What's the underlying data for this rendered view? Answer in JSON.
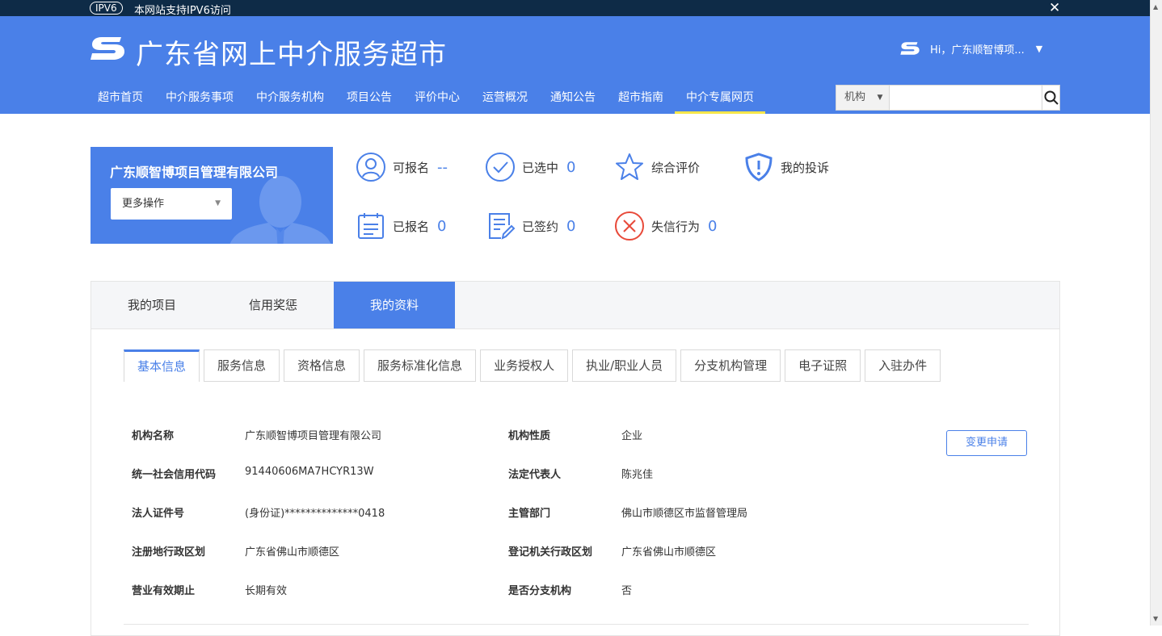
{
  "topbar": {
    "ipv6_badge": "IPV6",
    "ipv6_text": "本网站支持IPV6访问",
    "close": "✕"
  },
  "header": {
    "title": "广东省网上中介服务超市",
    "user_greeting": "Hi，广东顺智博项...",
    "nav": [
      "超市首页",
      "中介服务事项",
      "中介服务机构",
      "项目公告",
      "评价中心",
      "运营概况",
      "通知公告",
      "超市指南",
      "中介专属网页"
    ],
    "active_nav_index": 8,
    "search": {
      "select_value": "机构",
      "placeholder": ""
    }
  },
  "company": {
    "name": "广东顺智博项目管理有限公司",
    "more_ops": "更多操作"
  },
  "stats": {
    "can_apply": {
      "label": "可报名",
      "value": "--"
    },
    "selected": {
      "label": "已选中",
      "value": "0"
    },
    "rating": {
      "label": "综合评价"
    },
    "complaint": {
      "label": "我的投诉"
    },
    "applied": {
      "label": "已报名",
      "value": "0"
    },
    "signed": {
      "label": "已签约",
      "value": "0"
    },
    "dishonest": {
      "label": "失信行为",
      "value": "0"
    }
  },
  "tabs": [
    "我的项目",
    "信用奖惩",
    "我的资料"
  ],
  "active_tab_index": 2,
  "subtabs": [
    "基本信息",
    "服务信息",
    "资格信息",
    "服务标准化信息",
    "业务授权人",
    "执业/职业人员",
    "分支机构管理",
    "电子证照",
    "入驻办件"
  ],
  "active_subtab_index": 0,
  "info": {
    "org_name": {
      "label": "机构名称",
      "value": "广东顺智博项目管理有限公司"
    },
    "org_nature": {
      "label": "机构性质",
      "value": "企业"
    },
    "credit_code": {
      "label": "统一社会信用代码",
      "value": "91440606MA7HCYR13W"
    },
    "legal_rep": {
      "label": "法定代表人",
      "value": "陈兆佳"
    },
    "legal_id": {
      "label": "法人证件号",
      "value": "(身份证)**************0418"
    },
    "authority": {
      "label": "主管部门",
      "value": "佛山市顺德区市监督管理局"
    },
    "reg_area": {
      "label": "注册地行政区划",
      "value": "广东省佛山市顺德区"
    },
    "reg_office_area": {
      "label": "登记机关行政区划",
      "value": "广东省佛山市顺德区"
    },
    "validity": {
      "label": "营业有效期止",
      "value": "长期有效"
    },
    "is_branch": {
      "label": "是否分支机构",
      "value": "否"
    },
    "change_button": "变更申请"
  },
  "colors": {
    "brand": "#4a80e8",
    "topbar": "#0e2b47",
    "error": "#e84a3a",
    "active_underline": "#f5e64a"
  }
}
